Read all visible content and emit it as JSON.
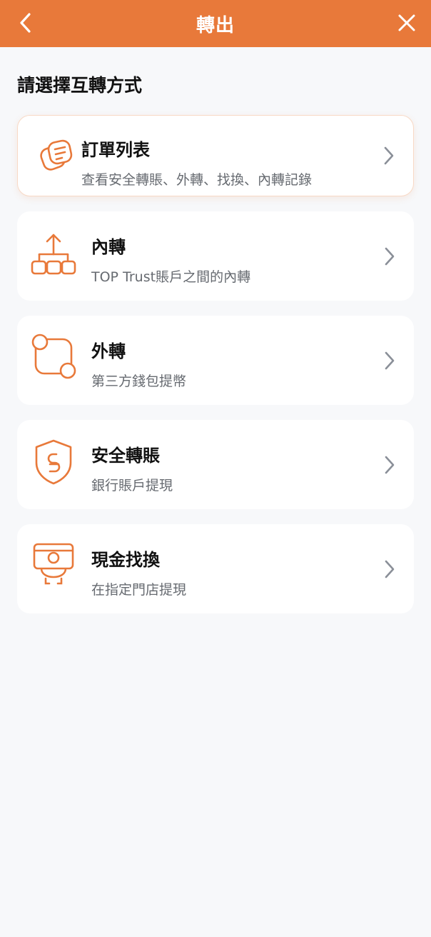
{
  "header": {
    "title": "轉出",
    "back_icon": "chevron-left-icon",
    "close_icon": "close-icon",
    "background": "#e8793a"
  },
  "section_title": "請選擇互轉方式",
  "options": [
    {
      "label": "訂單列表",
      "desc": "查看安全轉賬、外轉、找換、內轉記錄",
      "icon": "order-list-icon"
    },
    {
      "label": "內轉",
      "desc": "TOP Trust賬戶之間的內轉",
      "icon": "internal-transfer-icon"
    },
    {
      "label": "外轉",
      "desc": "第三方錢包提幣",
      "icon": "external-transfer-icon"
    },
    {
      "label": "安全轉賬",
      "desc": "銀行賬戶提現",
      "icon": "shield-currency-icon"
    },
    {
      "label": "現金找換",
      "desc": "在指定門店提現",
      "icon": "cash-exchange-icon"
    }
  ],
  "accent": "#e8793a",
  "chevron_color": "#8a8f98"
}
